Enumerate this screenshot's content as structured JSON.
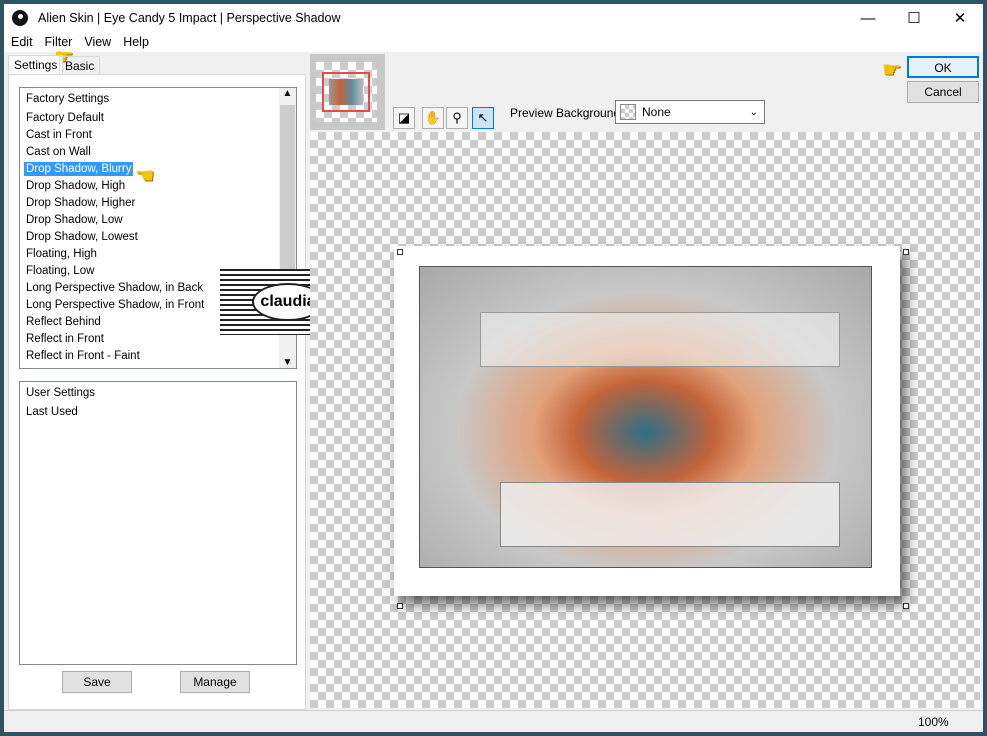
{
  "window": {
    "title": "Alien Skin | Eye Candy 5 Impact | Perspective Shadow",
    "minimize": "—",
    "maximize": "☐",
    "close": "✕"
  },
  "menu": [
    "Edit",
    "Filter",
    "View",
    "Help"
  ],
  "tabs": [
    "Settings",
    "Basic"
  ],
  "factory": {
    "header": "Factory Settings",
    "items": [
      "Factory Default",
      "Cast in Front",
      "Cast on Wall",
      "Drop Shadow, Blurry",
      "Drop Shadow, High",
      "Drop Shadow, Higher",
      "Drop Shadow, Low",
      "Drop Shadow, Lowest",
      "Floating, High",
      "Floating, Low",
      "Long Perspective Shadow, in Back",
      "Long Perspective Shadow, in Front",
      "Reflect Behind",
      "Reflect in Front",
      "Reflect in Front - Faint"
    ],
    "selected": "Drop Shadow, Blurry"
  },
  "user": {
    "header": "User Settings",
    "items": [
      "Last Used"
    ]
  },
  "buttons": {
    "save": "Save",
    "manage": "Manage",
    "ok": "OK",
    "cancel": "Cancel"
  },
  "preview": {
    "background_label": "Preview Background:",
    "background_value": "None"
  },
  "status": {
    "zoom": "100%"
  },
  "watermark": "claudia",
  "colors": {
    "selection": "#3399ff",
    "ok_border": "#0078d7",
    "thumbnail_border": "#e84a4a"
  }
}
